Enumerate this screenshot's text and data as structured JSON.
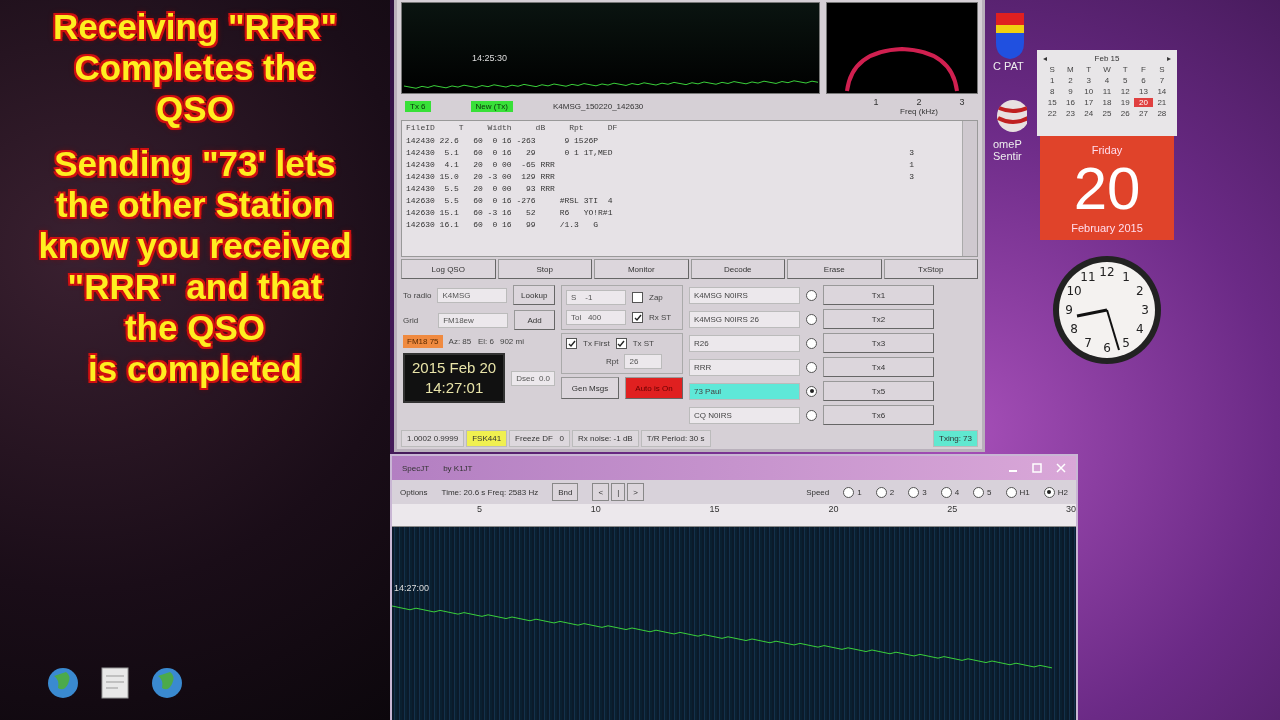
{
  "caption": {
    "paragraphs": [
      {
        "lines": [
          "Receiving \"RRR\"",
          "Completes the",
          "QSO"
        ]
      },
      {
        "lines": [
          "Sending \"73' lets",
          "the other Station",
          "know you received",
          "\"RRR\" and that",
          "the QSO",
          "is completed"
        ]
      }
    ]
  },
  "desktop_icons": [
    {
      "kind": "globe"
    },
    {
      "kind": "document"
    },
    {
      "kind": "globe"
    }
  ],
  "main_window": {
    "waterfall": {
      "timestamp": "14:25:30"
    },
    "freq_axis": {
      "ticks": [
        "1",
        "2",
        "3"
      ],
      "label": "Freq (kHz)"
    },
    "strip_badges": [
      "Tx 6",
      "New (Tx)"
    ],
    "filename": "K4MSG_150220_142630",
    "decode": {
      "columns": [
        "FileID",
        "T",
        "Width",
        "dB",
        "Rpt",
        "DF"
      ],
      "rows": [
        {
          "line": "142430 22.6   60  0 16 -263      9 1526P",
          "count": ""
        },
        {
          "line": "142430  5.1   60  0 16   29      0 1 1T,MED",
          "count": "3"
        },
        {
          "line": "142430  4.1   20  0 00  -65 RRR",
          "count": "1"
        },
        {
          "line": "142430 15.0   20 -3 00  129 RRR",
          "count": "3"
        },
        {
          "line": "142430  5.5   20  0 00   93 RRR",
          "count": ""
        },
        {
          "line": "142630  5.5   60  0 16 -276     #RSL 3TI  4",
          "count": ""
        },
        {
          "line": "142630 15.1   60 -3 16   52     R6   YO!R#1",
          "count": ""
        },
        {
          "line": "142630 16.1   60  0 16   99     /1.3   G",
          "count": ""
        }
      ]
    },
    "buttons": [
      "Log QSO",
      "Stop",
      "Monitor",
      "Decode",
      "Erase",
      "TxStop"
    ],
    "station": {
      "to_radio_label": "To radio",
      "to_radio": "K4MSG",
      "grid_label": "Grid",
      "grid": "FM18ew",
      "lookup": "Lookup",
      "add": "Add",
      "locator": "FM18 75",
      "azel": "Az: 85   El: 6",
      "distance": "902 mi",
      "date": "2015 Feb 20",
      "time": "14:27:01",
      "dsec": "Dsec  0.0"
    },
    "settings": {
      "s_spin": "S    -1",
      "tol": "Tol   400",
      "zap": {
        "label": "Zap",
        "checked": false
      },
      "rx_st": {
        "label": "Rx ST",
        "checked": true
      },
      "tx_first": {
        "label": "Tx First",
        "checked": true
      },
      "tx_st": {
        "label": "Tx ST",
        "checked": true
      },
      "rpt_label": "Rpt",
      "rpt": "26",
      "gen_msgs": "Gen Msgs",
      "auto": {
        "label": "Auto is On",
        "on": true
      }
    },
    "messages": [
      {
        "text": "K4MSG N0IRS",
        "selected": false,
        "button": "Tx1"
      },
      {
        "text": "K4MSG N0IRS 26",
        "selected": false,
        "button": "Tx2"
      },
      {
        "text": "R26",
        "selected": false,
        "button": "Tx3"
      },
      {
        "text": "RRR",
        "selected": false,
        "button": "Tx4"
      },
      {
        "text": "73 Paul",
        "selected": true,
        "button": "Tx5"
      },
      {
        "text": "CQ N0IRS",
        "selected": false,
        "button": "Tx6"
      }
    ],
    "status_bar": [
      {
        "text": "1.0002 0.9999",
        "kind": "plain"
      },
      {
        "text": "FSK441",
        "kind": "mode"
      },
      {
        "text": "Freeze DF   0",
        "kind": "plain"
      },
      {
        "text": "Rx noise: -1 dB",
        "kind": "plain"
      },
      {
        "text": "T/R Period: 30 s",
        "kind": "plain"
      },
      {
        "text": "Txing: 73",
        "kind": "transmit"
      }
    ]
  },
  "spec_window": {
    "title": "SpecJT",
    "subtitle": "by K1JT",
    "menu": "Options",
    "readout": "Time: 20.6 s  Freq: 2583 Hz",
    "band_button": "Bnd",
    "nav": [
      "<",
      "|",
      ">"
    ],
    "speed_label": "Speed",
    "speeds": [
      {
        "label": "1",
        "selected": false
      },
      {
        "label": "2",
        "selected": false
      },
      {
        "label": "3",
        "selected": false
      },
      {
        "label": "4",
        "selected": false
      },
      {
        "label": "5",
        "selected": false
      },
      {
        "label": "H1",
        "selected": false
      },
      {
        "label": "H2",
        "selected": true
      }
    ],
    "ruler": [
      "5",
      "10",
      "15",
      "20",
      "25",
      "30"
    ],
    "timestamp": "14:27:00"
  },
  "right_icons": [
    {
      "kind": "shield",
      "lines": [
        "C PAT"
      ]
    },
    {
      "kind": "ball",
      "lines": [
        "omeP",
        "Sentir"
      ]
    }
  ],
  "calendar": {
    "month": "Feb 15",
    "prev": "◂",
    "next": "▸",
    "weekdays": [
      "S",
      "M",
      "T",
      "W",
      "T",
      "F",
      "S"
    ],
    "days": [
      {
        "day": "1",
        "selected": false
      },
      {
        "day": "2",
        "selected": false
      },
      {
        "day": "3",
        "selected": false
      },
      {
        "day": "4",
        "selected": false
      },
      {
        "day": "5",
        "selected": false
      },
      {
        "day": "6",
        "selected": false
      },
      {
        "day": "7",
        "selected": false
      },
      {
        "day": "8",
        "selected": false
      },
      {
        "day": "9",
        "selected": false
      },
      {
        "day": "10",
        "selected": false
      },
      {
        "day": "11",
        "selected": false
      },
      {
        "day": "12",
        "selected": false
      },
      {
        "day": "13",
        "selected": false
      },
      {
        "day": "14",
        "selected": false
      },
      {
        "day": "15",
        "selected": false
      },
      {
        "day": "16",
        "selected": false
      },
      {
        "day": "17",
        "selected": false
      },
      {
        "day": "18",
        "selected": false
      },
      {
        "day": "19",
        "selected": false
      },
      {
        "day": "20",
        "selected": true
      },
      {
        "day": "21",
        "selected": false
      },
      {
        "day": "22",
        "selected": false
      },
      {
        "day": "23",
        "selected": false
      },
      {
        "day": "24",
        "selected": false
      },
      {
        "day": "25",
        "selected": false
      },
      {
        "day": "26",
        "selected": false
      },
      {
        "day": "27",
        "selected": false
      },
      {
        "day": "28",
        "selected": false
      }
    ],
    "weekday": "Friday",
    "day": "20",
    "month_year": "February 2015"
  },
  "clock": {
    "numerals": [
      "12",
      "11",
      "1",
      "10",
      "2",
      "9",
      "3",
      "8",
      "4",
      "7",
      "5",
      "6"
    ]
  }
}
